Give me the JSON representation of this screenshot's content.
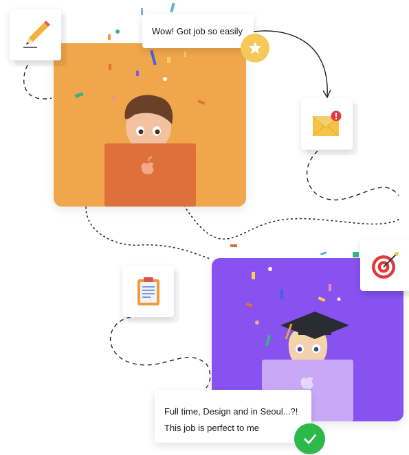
{
  "bubbles": {
    "top": "Wow! Got job so easily",
    "bottom_line1": "Full time, Design and in Seoul...?!",
    "bottom_line2": "This job is perfect to me"
  },
  "icons": {
    "pencil": "pencil-icon",
    "mail": "mail-notification-icon",
    "target": "target-icon",
    "clipboard": "clipboard-icon",
    "star": "star-icon",
    "check": "check-icon"
  },
  "colors": {
    "orange_card": "#F0A64A",
    "purple_card": "#8752F0",
    "star_badge": "#F5C85A",
    "check_badge": "#2DB84B",
    "laptop_orange": "#E0703A",
    "laptop_purple": "#C9A9F7"
  }
}
